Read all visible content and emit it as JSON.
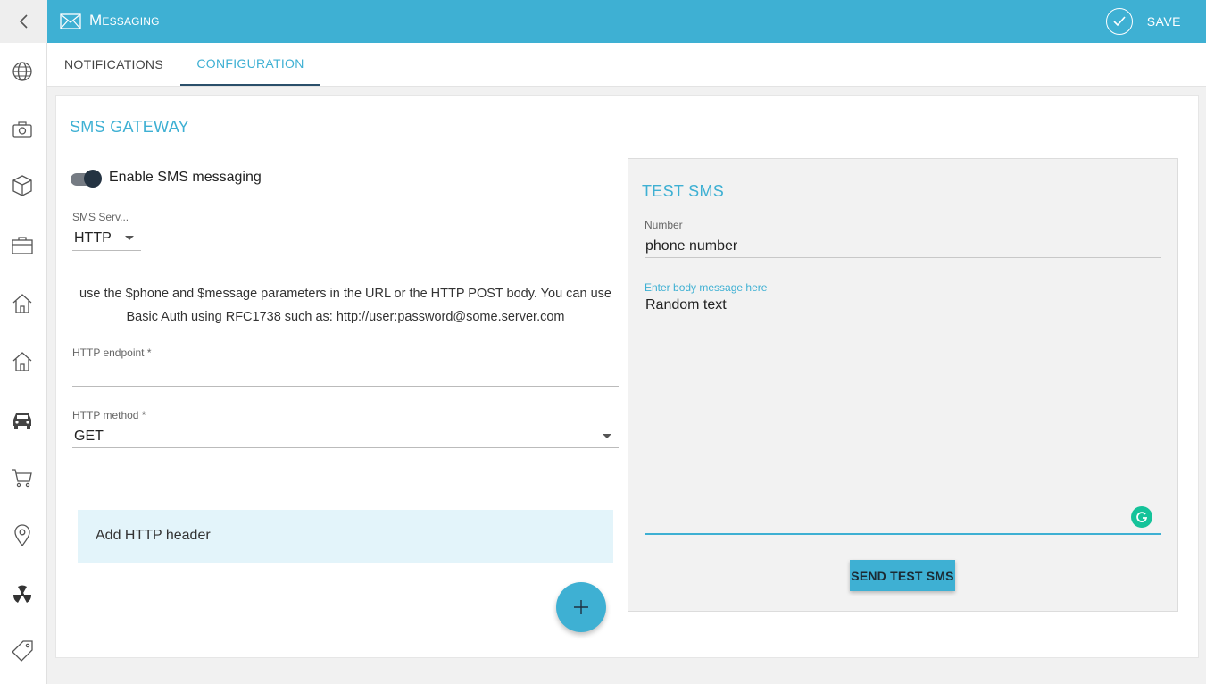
{
  "header": {
    "title": "Messaging",
    "save_label": "SAVE",
    "icon": "mail-icon",
    "bg_color": "#3eb0d3"
  },
  "sidebar": {
    "back_icon": "chevron-left-icon",
    "items": [
      {
        "icon": "globe-icon"
      },
      {
        "icon": "camera-icon"
      },
      {
        "icon": "cube-icon"
      },
      {
        "icon": "briefcase-icon"
      },
      {
        "icon": "home-icon"
      },
      {
        "icon": "home-outline-icon"
      },
      {
        "icon": "car-icon"
      },
      {
        "icon": "cart-icon"
      },
      {
        "icon": "location-pin-icon"
      },
      {
        "icon": "radiation-icon"
      },
      {
        "icon": "tag-icon"
      }
    ]
  },
  "tabs": [
    {
      "label": "NOTIFICATIONS",
      "active": false
    },
    {
      "label": "CONFIGURATION",
      "active": true
    }
  ],
  "gateway": {
    "title": "SMS GATEWAY",
    "enable_label": "Enable SMS messaging",
    "enabled": true,
    "provider_label": "SMS Serv...",
    "provider_value": "HTTP",
    "help_text": "use the $phone and $message parameters in the URL or the HTTP POST body. You can use Basic Auth using RFC1738 such as: http://user:password@some.server.com",
    "endpoint_label": "HTTP endpoint *",
    "endpoint_value": "",
    "method_label": "HTTP method *",
    "method_value": "GET",
    "add_header_label": "Add HTTP header"
  },
  "test_sms": {
    "title": "TEST SMS",
    "number_label": "Number",
    "number_placeholder": "phone number",
    "body_label": "Enter body message here",
    "body_value": "Random text",
    "send_label": "SEND TEST SMS"
  }
}
